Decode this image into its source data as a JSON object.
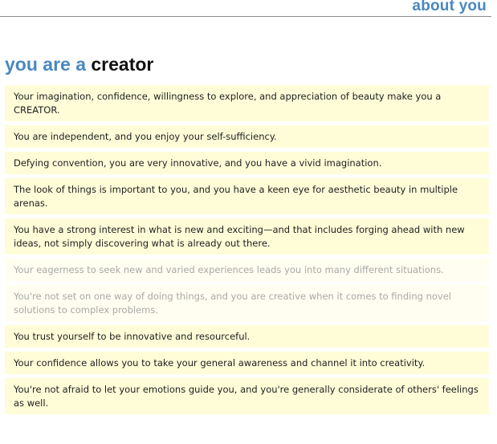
{
  "header": {
    "title": "about you"
  },
  "headline": {
    "prefix": "you are a",
    "type": "creator"
  },
  "traits": [
    "Your imagination, confidence, willingness to explore, and appreciation of beauty make you a CREATOR.",
    "You are independent, and you enjoy your self-sufficiency.",
    "Defying convention, you are very innovative, and you have a vivid imagination.",
    "The look of things is important to you, and you have a keen eye for aesthetic beauty in multiple arenas.",
    "You have a strong interest in what is new and exciting—and that includes forging ahead with new ideas, not simply discovering what is already out there.",
    "Your eagerness to seek new and varied experiences leads you into many different situations.",
    "You're not set on one way of doing things, and you are creative when it comes to finding novel solutions to complex problems.",
    "You trust yourself to be innovative and resourceful.",
    "Your confidence allows you to take your general awareness and channel it into creativity.",
    "You're not afraid to let your emotions guide you, and you're generally considerate of others' feelings as well."
  ]
}
